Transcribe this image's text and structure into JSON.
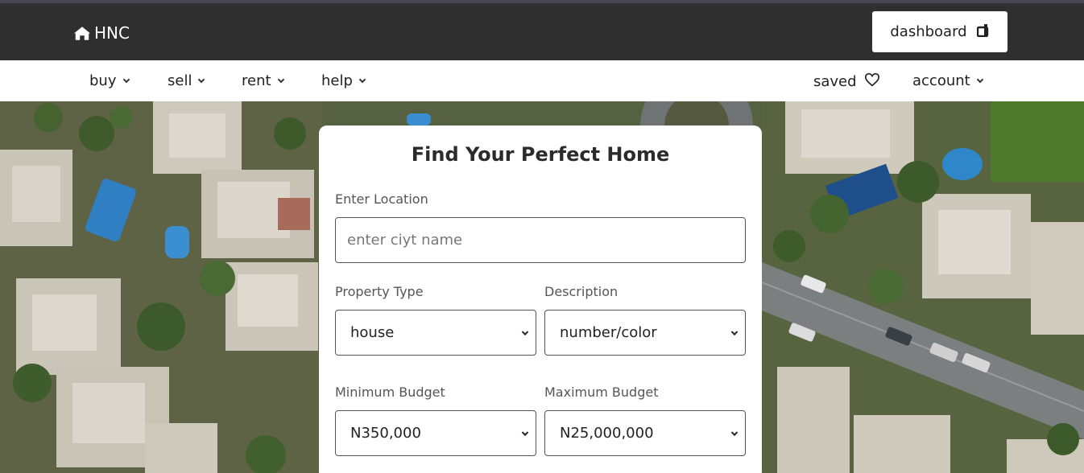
{
  "header": {
    "brand": "HNC",
    "dashboard_label": "dashboard"
  },
  "nav": {
    "buy": "buy",
    "sell": "sell",
    "rent": "rent",
    "help": "help",
    "saved": "saved",
    "account": "account"
  },
  "search": {
    "title": "Find Your Perfect Home",
    "location_label": "Enter Location",
    "location_placeholder": "enter ciyt name",
    "property_type_label": "Property Type",
    "property_type_value": "house",
    "description_label": "Description",
    "description_value": "number/color",
    "min_budget_label": "Minimum Budget",
    "min_budget_value": "N350,000",
    "max_budget_label": "Maximum Budget",
    "max_budget_value": "N25,000,000"
  },
  "icons": {
    "brand": "home-icon",
    "dashboard": "dashboard-icon",
    "saved": "heart-icon",
    "dropdown": "chevron-down-icon"
  },
  "colors": {
    "header_bg": "#302f2f",
    "accent": "#ffffff"
  }
}
